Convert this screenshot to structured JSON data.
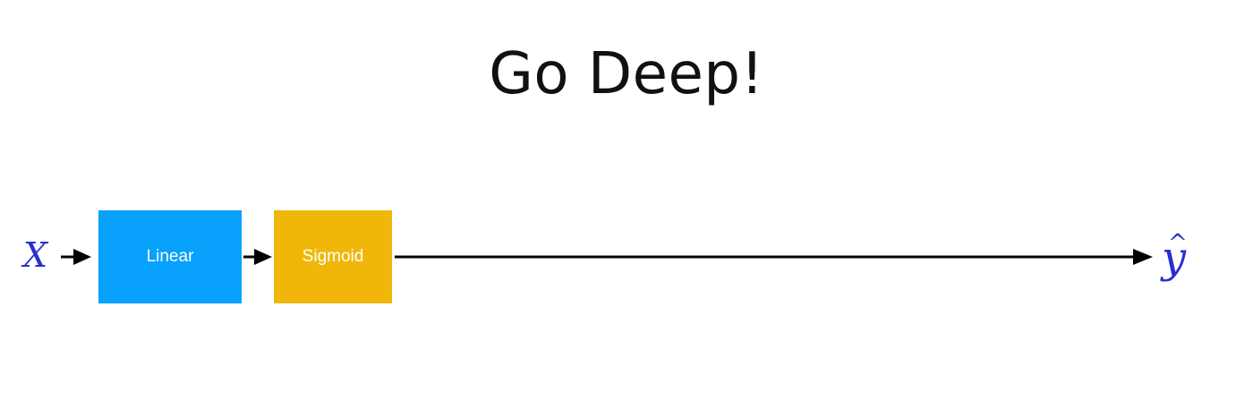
{
  "title": "Go Deep!",
  "input_label": "X",
  "output_label": "y",
  "output_hat": "^",
  "blocks": [
    {
      "label": "Linear",
      "color": "#08a1fb"
    },
    {
      "label": "Sigmoid",
      "color": "#f0b70a"
    }
  ],
  "colors": {
    "variable": "#2a2ed0",
    "arrow": "#000000"
  }
}
